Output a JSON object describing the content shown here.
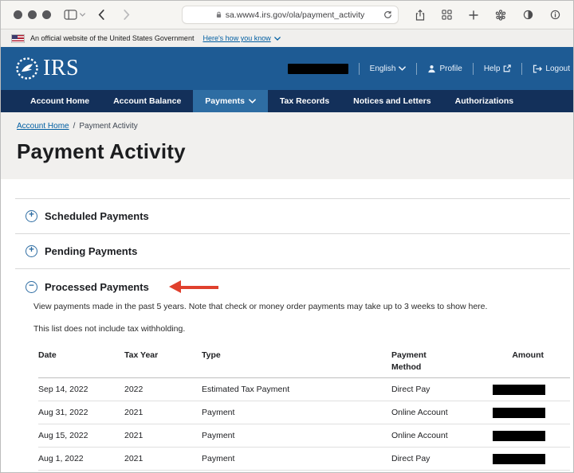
{
  "browser": {
    "url": "sa.www4.irs.gov/ola/payment_activity"
  },
  "gov_banner": {
    "text": "An official website of the United States Government",
    "link_label": "Here's how you know"
  },
  "header": {
    "logo_text": "IRS",
    "language_label": "English",
    "profile_label": "Profile",
    "help_label": "Help",
    "logout_label": "Logout"
  },
  "nav": {
    "items": [
      {
        "label": "Account Home"
      },
      {
        "label": "Account Balance"
      },
      {
        "label": "Payments"
      },
      {
        "label": "Tax Records"
      },
      {
        "label": "Notices and Letters"
      },
      {
        "label": "Authorizations"
      }
    ],
    "active_item": "Payments"
  },
  "breadcrumb": {
    "home": "Account Home",
    "separator": "/",
    "current": "Payment Activity"
  },
  "page": {
    "title": "Payment Activity"
  },
  "sections": {
    "scheduled": {
      "label": "Scheduled Payments",
      "state": "collapsed"
    },
    "pending": {
      "label": "Pending Payments",
      "state": "collapsed"
    },
    "processed": {
      "label": "Processed Payments",
      "state": "expanded",
      "description": "View payments made in the past 5 years. Note that check or money order payments may take up to 3 weeks to show here.",
      "note": "This list does not include tax withholding."
    }
  },
  "table": {
    "headers": [
      "Date",
      "Tax Year",
      "Type",
      "Payment Method",
      "Amount"
    ],
    "rows": [
      {
        "date": "Sep 14, 2022",
        "tax_year": "2022",
        "type": "Estimated Tax Payment",
        "method": "Direct Pay",
        "amount_redacted": true
      },
      {
        "date": "Aug 31, 2022",
        "tax_year": "2021",
        "type": "Payment",
        "method": "Online Account",
        "amount_redacted": true
      },
      {
        "date": "Aug 15, 2022",
        "tax_year": "2021",
        "type": "Payment",
        "method": "Online Account",
        "amount_redacted": true
      },
      {
        "date": "Aug 1, 2022",
        "tax_year": "2021",
        "type": "Payment",
        "method": "Direct Pay",
        "amount_redacted": true
      }
    ]
  },
  "colors": {
    "header_blue": "#1e5b94",
    "nav_navy": "#13305a",
    "nav_active_blue": "#2e6da3",
    "link_blue": "#005ea2",
    "annotation_arrow_red": "#e0402d",
    "redaction_black": "#000000"
  }
}
